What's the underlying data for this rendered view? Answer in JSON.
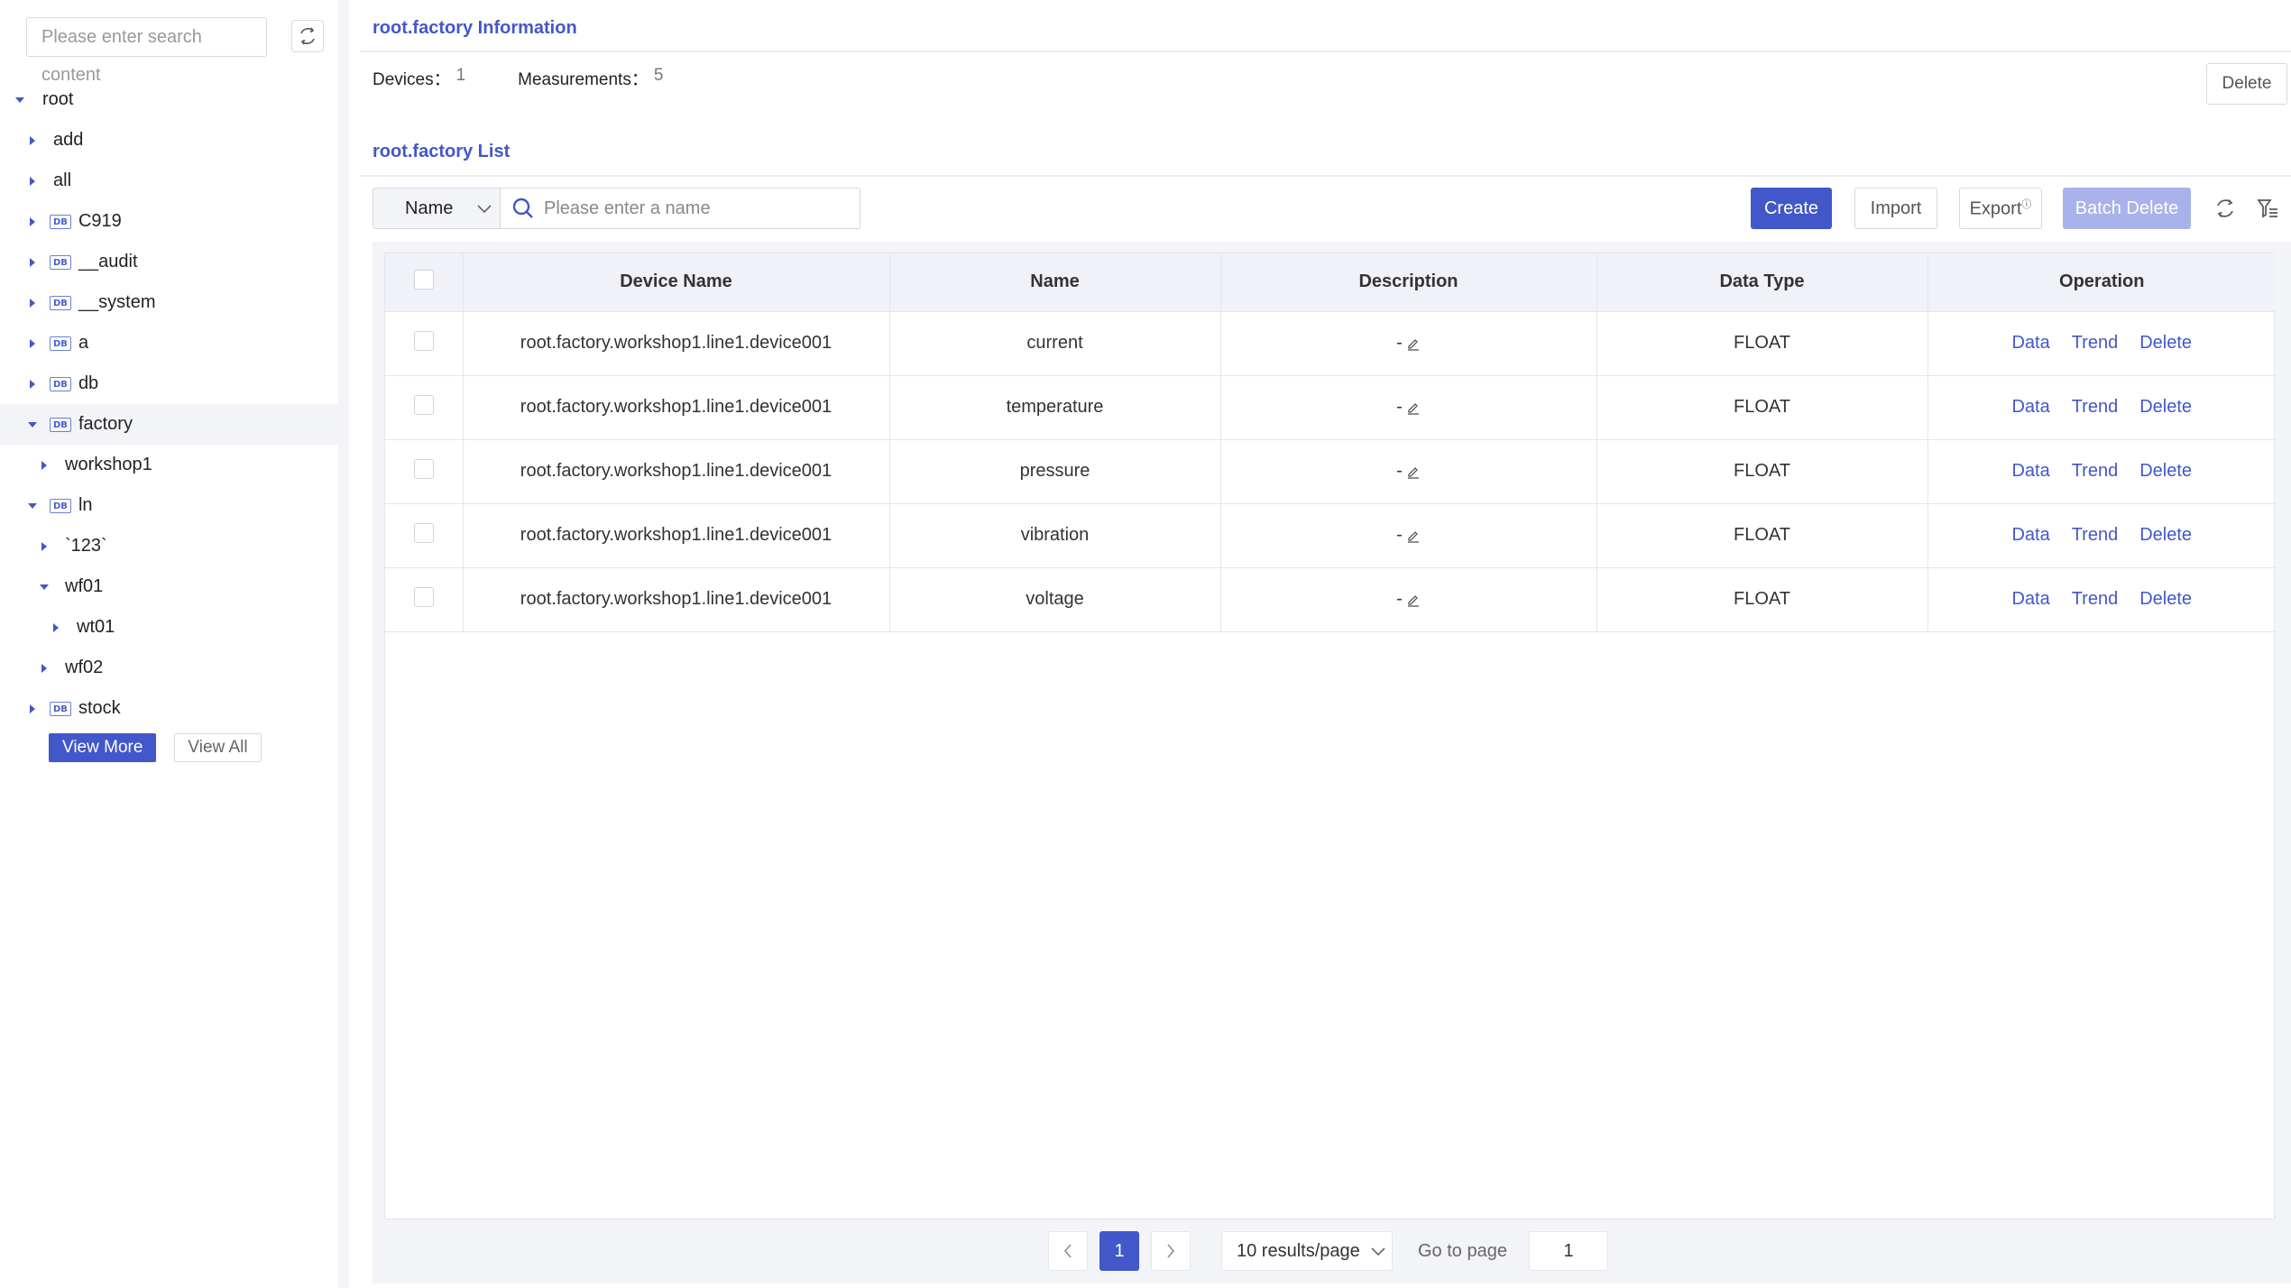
{
  "sidebar": {
    "search_placeholder": "Please enter search content",
    "tree": [
      {
        "label": "root",
        "level": 0,
        "expanded": true,
        "db": false
      },
      {
        "label": "add",
        "level": 1,
        "expanded": false,
        "db": false
      },
      {
        "label": "all",
        "level": 1,
        "expanded": false,
        "db": false
      },
      {
        "label": "C919",
        "level": 1,
        "expanded": false,
        "db": true
      },
      {
        "label": "__audit",
        "level": 1,
        "expanded": false,
        "db": true
      },
      {
        "label": "__system",
        "level": 1,
        "expanded": false,
        "db": true
      },
      {
        "label": "a",
        "level": 1,
        "expanded": false,
        "db": true
      },
      {
        "label": "db",
        "level": 1,
        "expanded": false,
        "db": true
      },
      {
        "label": "factory",
        "level": 1,
        "expanded": true,
        "db": true,
        "selected": true
      },
      {
        "label": "workshop1",
        "level": 2,
        "expanded": false,
        "db": false
      },
      {
        "label": "ln",
        "level": 1,
        "expanded": true,
        "db": true
      },
      {
        "label": "`123`",
        "level": 2,
        "expanded": false,
        "db": false
      },
      {
        "label": "wf01",
        "level": 2,
        "expanded": true,
        "db": false
      },
      {
        "label": "wt01",
        "level": 3,
        "expanded": false,
        "db": false
      },
      {
        "label": "wf02",
        "level": 2,
        "expanded": false,
        "db": false
      },
      {
        "label": "stock",
        "level": 1,
        "expanded": false,
        "db": true
      }
    ],
    "db_badge": "DB",
    "view_more": "View More",
    "view_all": "View All"
  },
  "info": {
    "title": "root.factory Information",
    "devices_label": "Devices：",
    "devices_value": "1",
    "measurements_label": "Measurements：",
    "measurements_value": "5",
    "delete_label": "Delete"
  },
  "list": {
    "title": "root.factory List",
    "filter_field": "Name",
    "filter_placeholder": "Please enter a name",
    "create": "Create",
    "import": "Import",
    "export": "Export",
    "export_sup": "ⓘ",
    "batch_delete": "Batch Delete",
    "columns": [
      "Device Name",
      "Name",
      "Description",
      "Data Type",
      "Operation"
    ],
    "rows": [
      {
        "device": "root.factory.workshop1.line1.device001",
        "name": "current",
        "description": "-",
        "type": "FLOAT"
      },
      {
        "device": "root.factory.workshop1.line1.device001",
        "name": "temperature",
        "description": "-",
        "type": "FLOAT"
      },
      {
        "device": "root.factory.workshop1.line1.device001",
        "name": "pressure",
        "description": "-",
        "type": "FLOAT"
      },
      {
        "device": "root.factory.workshop1.line1.device001",
        "name": "vibration",
        "description": "-",
        "type": "FLOAT"
      },
      {
        "device": "root.factory.workshop1.line1.device001",
        "name": "voltage",
        "description": "-",
        "type": "FLOAT"
      }
    ],
    "ops": {
      "data": "Data",
      "trend": "Trend",
      "delete": "Delete"
    }
  },
  "pagination": {
    "current_page": "1",
    "page_size": "10 results/page",
    "goto_label": "Go to page",
    "goto_value": "1"
  },
  "colors": {
    "accent": "#4257c9",
    "accent_light": "#a9b2ea",
    "panel": "#f3f4f8"
  }
}
